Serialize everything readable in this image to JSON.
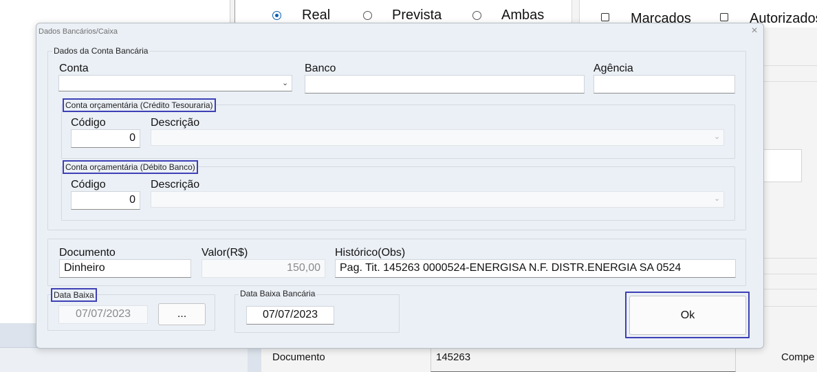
{
  "background": {
    "filter_radios": [
      {
        "label": "Real",
        "selected": true
      },
      {
        "label": "Prevista",
        "selected": false
      },
      {
        "label": "Ambas",
        "selected": false
      }
    ],
    "checkboxes": [
      {
        "label": "Marcados",
        "checked": false
      },
      {
        "label": "Autorizados",
        "checked": false
      }
    ],
    "documento_label": "Documento",
    "documento_value": "145263",
    "compe_label": "Compe"
  },
  "dialog": {
    "title": "Dados Bancários/Caixa",
    "close_icon": "×",
    "conta_bancaria": {
      "legend": "Dados da Conta Bancária",
      "conta_label": "Conta",
      "conta_value": "",
      "banco_label": "Banco",
      "banco_value": "",
      "agencia_label": "Agência",
      "agencia_value": ""
    },
    "credito_tesouraria": {
      "legend": "Conta orçamentária (Crédito Tesouraria)",
      "codigo_label": "Código",
      "codigo_value": "0",
      "descricao_label": "Descrição",
      "descricao_value": ""
    },
    "debito_banco": {
      "legend": "Conta orçamentária (Débito Banco)",
      "codigo_label": "Código",
      "codigo_value": "0",
      "descricao_label": "Descrição",
      "descricao_value": ""
    },
    "documento": {
      "documento_label": "Documento",
      "documento_value": "Dinheiro",
      "valor_label": "Valor(R$)",
      "valor_value": "150,00",
      "historico_label": "Histórico(Obs)",
      "historico_value": "Pag. Tit. 145263 0000524-ENERGISA N.F. DISTR.ENERGIA SA 0524"
    },
    "data_baixa": {
      "legend": "Data Baixa",
      "value": "07/07/2023",
      "picker_label": "..."
    },
    "data_baixa_bancaria": {
      "legend": "Data Baixa Bancária",
      "value": "07/07/2023"
    },
    "ok_label": "Ok"
  },
  "colors": {
    "highlight": "#3d3fb5",
    "dialog_bg": "#ebf0f6",
    "radio_selected": "#0a5fb0"
  }
}
